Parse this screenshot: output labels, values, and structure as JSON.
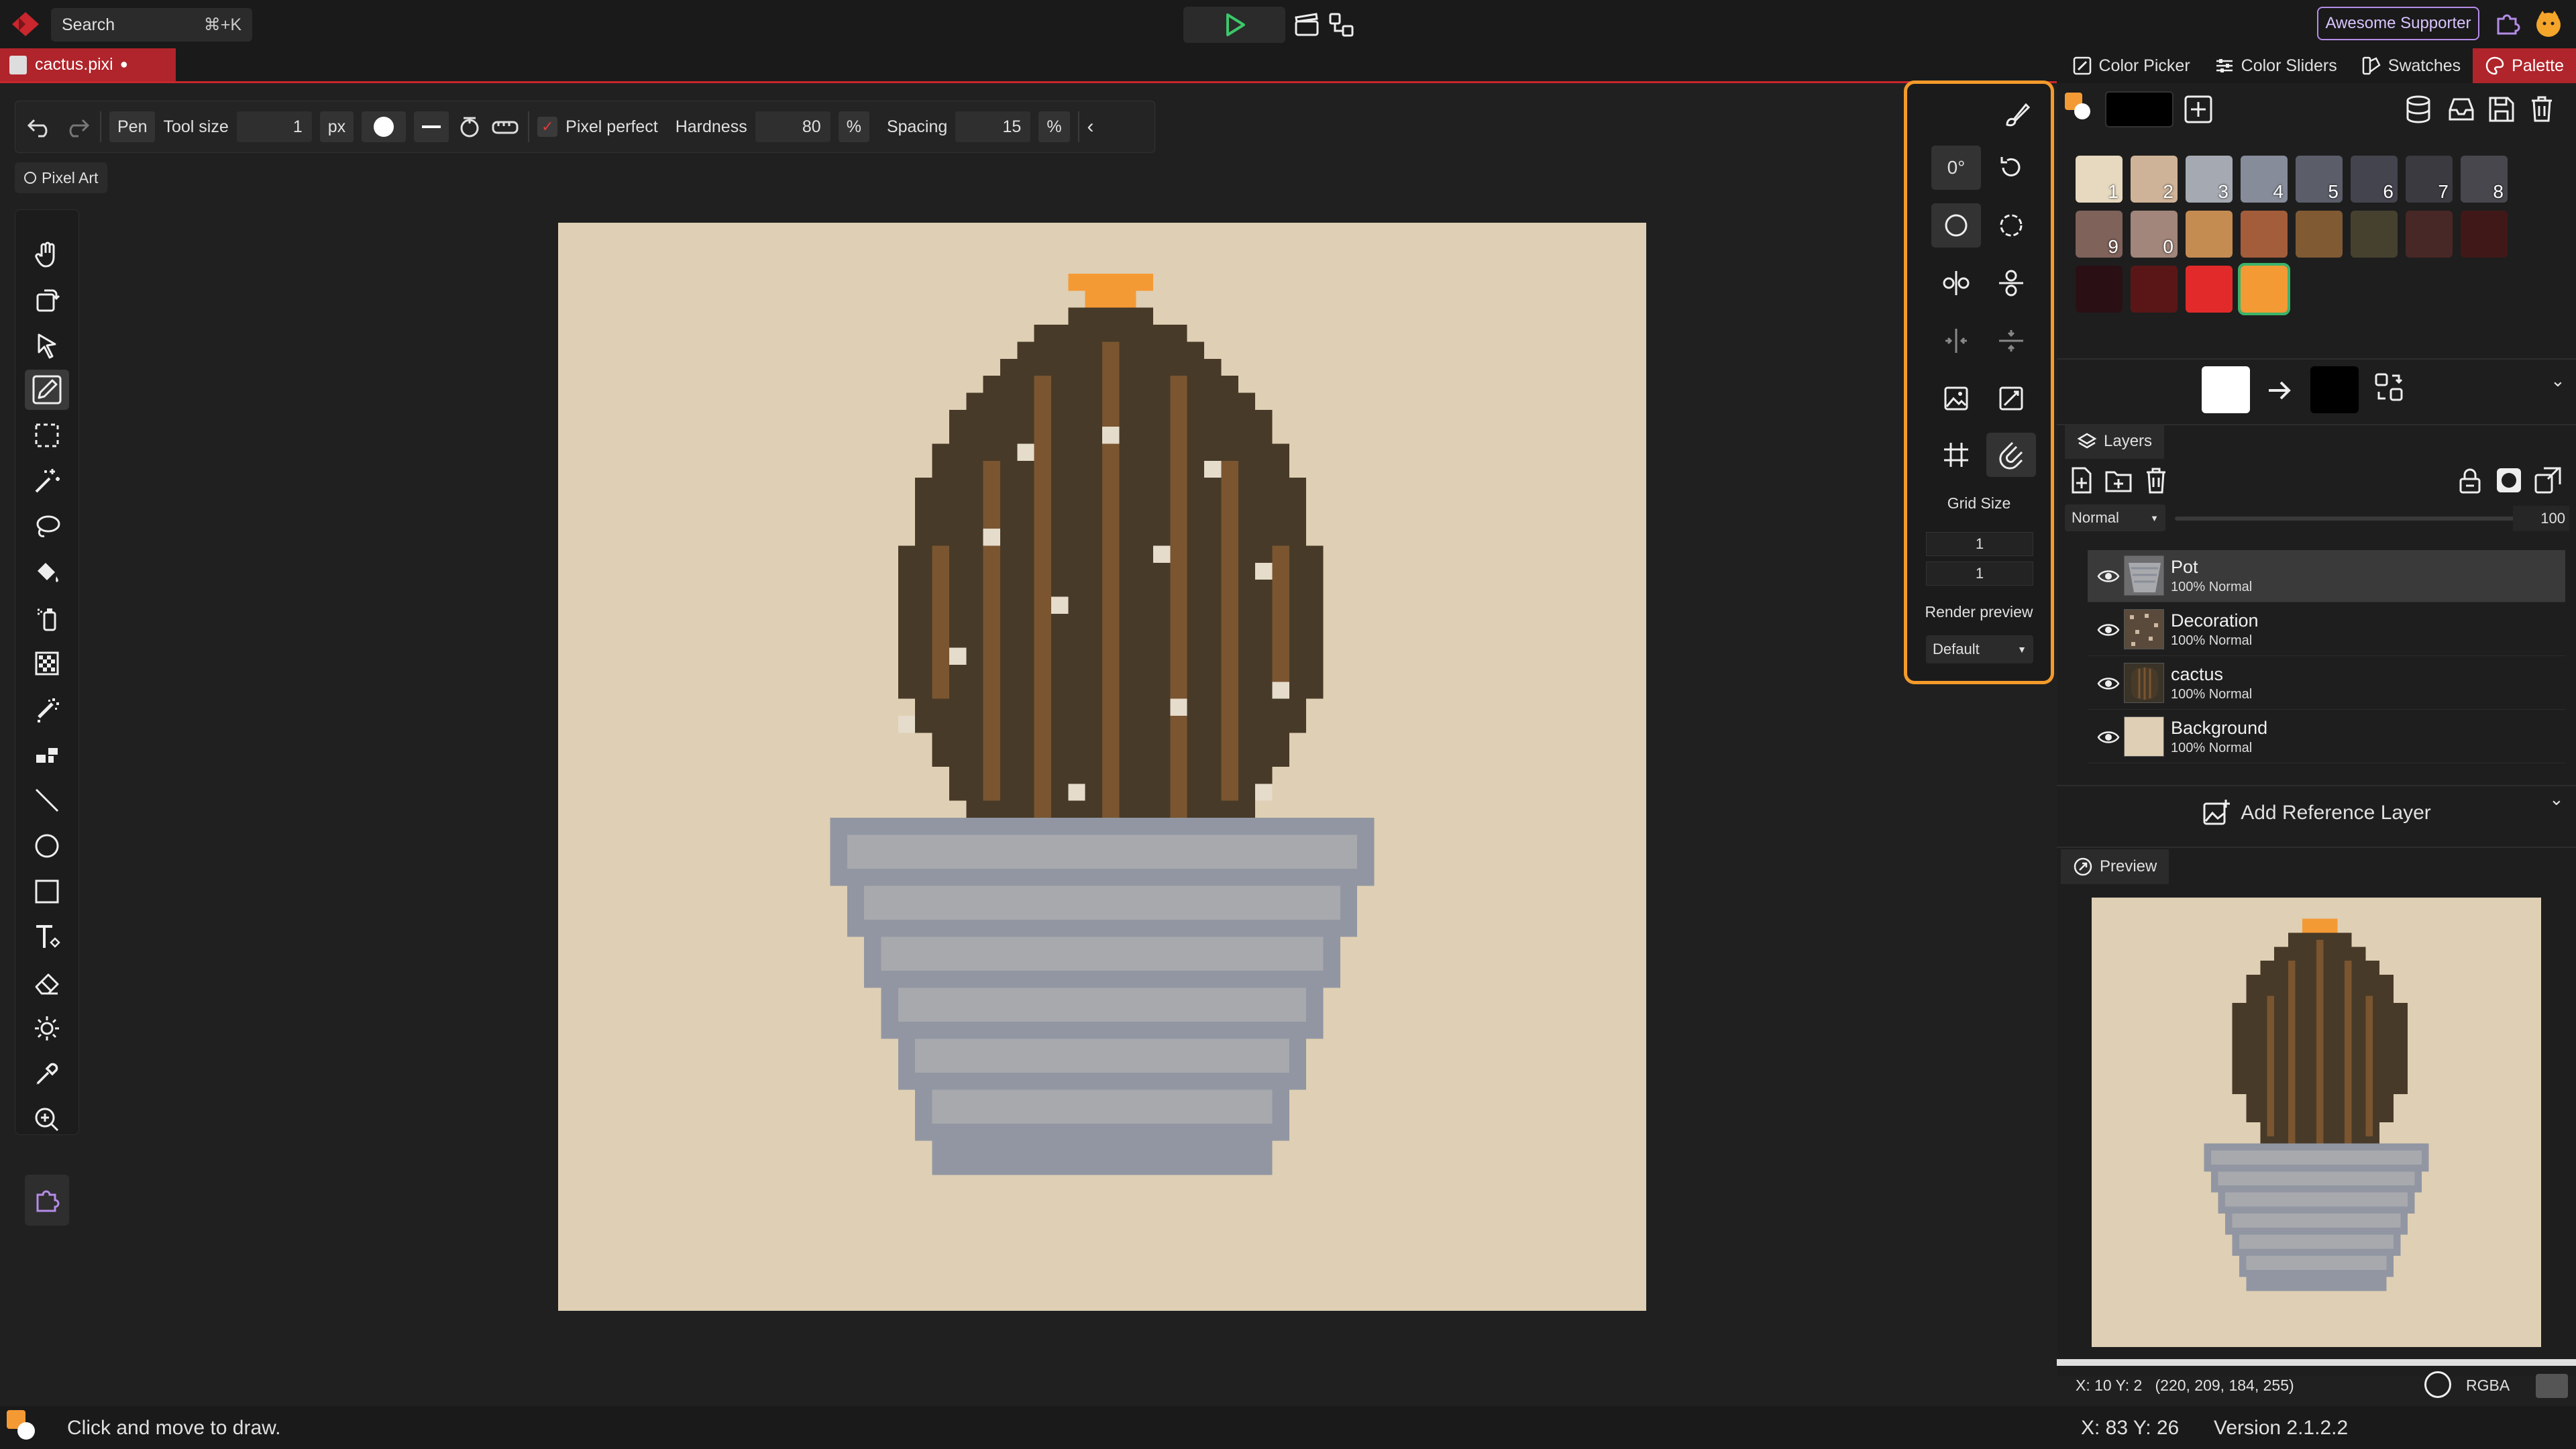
{
  "app": {
    "search_label": "Search",
    "search_shortcut": "⌘+K",
    "supporter_label": "Awesome Supporter"
  },
  "document": {
    "tab_name": "cactus.pixi",
    "unsaved_dot": "●"
  },
  "tool_options": {
    "tool_name": "Pen",
    "tool_size_label": "Tool size",
    "tool_size_value": "1",
    "tool_size_unit": "px",
    "pixel_perfect_label": "Pixel perfect",
    "pixel_perfect_checked": true,
    "hardness_label": "Hardness",
    "hardness_value": "80",
    "hardness_unit": "%",
    "spacing_label": "Spacing",
    "spacing_value": "15",
    "spacing_unit": "%"
  },
  "mode_chip": "Pixel Art",
  "toolbar": {
    "tools": [
      "move-view",
      "rotate-view",
      "select",
      "pen",
      "rectangle-select",
      "magic-wand",
      "lasso",
      "fill",
      "brightness-bucket",
      "noise-fill",
      "dither",
      "blocks",
      "line",
      "ellipse",
      "rectangle",
      "text",
      "eraser",
      "brightness",
      "color-picker",
      "zoom",
      "plugins"
    ],
    "active_tool": "pen"
  },
  "grid_panel": {
    "rotation_label": "0°",
    "grid_size_label": "Grid Size",
    "grid_size_x": "1",
    "grid_size_y": "1",
    "render_preview_label": "Render preview",
    "render_preview_value": "Default"
  },
  "right_panel": {
    "tabs": [
      {
        "label": "Color Picker",
        "icon": "color-picker-icon"
      },
      {
        "label": "Color Sliders",
        "icon": "sliders-icon"
      },
      {
        "label": "Swatches",
        "icon": "swatches-icon"
      },
      {
        "label": "Palette",
        "icon": "palette-icon",
        "active": true
      }
    ],
    "palette": [
      {
        "color": "#e7d9bf",
        "num": "1"
      },
      {
        "color": "#cfb398",
        "num": "2"
      },
      {
        "color": "#a5a9b2",
        "num": "3"
      },
      {
        "color": "#868c9a",
        "num": "4"
      },
      {
        "color": "#5b5e69",
        "num": "5"
      },
      {
        "color": "#44444e",
        "num": "6"
      },
      {
        "color": "#3a3a40",
        "num": "7"
      },
      {
        "color": "#47474d",
        "num": "8"
      },
      {
        "color": "#7f625a",
        "num": "9"
      },
      {
        "color": "#a2867b",
        "num": "0"
      },
      {
        "color": "#c58c52",
        "num": ""
      },
      {
        "color": "#a45d3a",
        "num": ""
      },
      {
        "color": "#7f5a33",
        "num": ""
      },
      {
        "color": "#46412f",
        "num": ""
      },
      {
        "color": "#482826",
        "num": ""
      },
      {
        "color": "#401818",
        "num": ""
      },
      {
        "color": "#2a1014",
        "num": ""
      },
      {
        "color": "#5a1616",
        "num": ""
      },
      {
        "color": "#e22a2a",
        "num": ""
      },
      {
        "color": "#f49a35",
        "num": ""
      }
    ],
    "primary_color": "#ffffff",
    "secondary_color": "#000000",
    "layers_tab": "Layers",
    "blend_mode": "Normal",
    "opacity_value": "100",
    "layers": [
      {
        "name": "Pot",
        "opacity": "100%",
        "mode": "Normal",
        "selected": true
      },
      {
        "name": "Decoration",
        "opacity": "100%",
        "mode": "Normal"
      },
      {
        "name": "cactus",
        "opacity": "100%",
        "mode": "Normal"
      },
      {
        "name": "Background",
        "opacity": "100%",
        "mode": "Normal"
      }
    ],
    "add_reference_label": "Add Reference Layer",
    "preview_tab": "Preview",
    "pixel_info": "X: 10 Y: 2   (220, 209, 184, 255)",
    "color_mode": "RGBA"
  },
  "status": {
    "hint": "Click and move to draw.",
    "cursor_pos": "X: 83 Y: 26",
    "version": "Version 2.1.2.2"
  },
  "colors": {
    "accent_red": "#c9262e",
    "grid_panel_border": "#f39a2b",
    "canvas_bg": "#dfcfb4",
    "cactus_dark": "#473a28",
    "cactus_stripe": "#7a5530",
    "pot_light": "#a8a9ad",
    "pot_dark": "#9196a2",
    "flower": "#f49a35"
  }
}
